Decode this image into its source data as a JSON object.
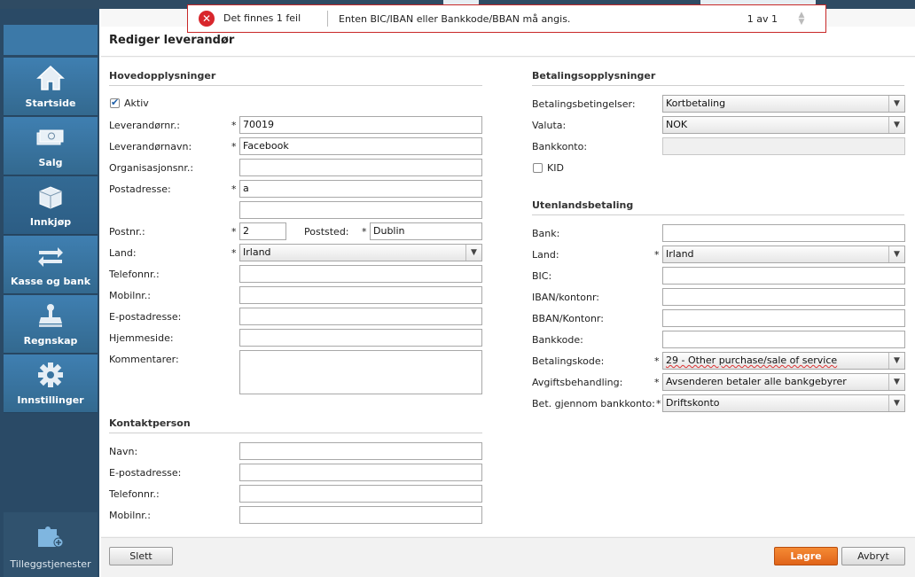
{
  "error_banner": {
    "count_text": "Det finnes 1 feil",
    "message": "Enten BIC/IBAN eller Bankkode/BBAN må angis.",
    "page": "1 av 1",
    "error_color": "#d8262c"
  },
  "sidebar": {
    "items": [
      {
        "label": "Startside",
        "icon": "home-icon"
      },
      {
        "label": "Salg",
        "icon": "money-icon"
      },
      {
        "label": "Innkjøp",
        "icon": "box-icon"
      },
      {
        "label": "Kasse og bank",
        "icon": "transfer-icon"
      },
      {
        "label": "Regnskap",
        "icon": "stamp-icon"
      },
      {
        "label": "Innstillinger",
        "icon": "gear-icon"
      }
    ],
    "addons_label": "Tilleggstjenester"
  },
  "page_title": "Rediger leverandør",
  "main_info": {
    "heading": "Hovedopplysninger",
    "active_label": "Aktiv",
    "active_checked": true,
    "supplier_no_label": "Leverandørnr.:",
    "supplier_no": "70019",
    "supplier_name_label": "Leverandørnavn:",
    "supplier_name": "Facebook",
    "org_no_label": "Organisasjonsnr.:",
    "org_no": "",
    "address_label": "Postadresse:",
    "address1": "a",
    "address2": "",
    "postal_no_label": "Postnr.:",
    "postal_no": "2",
    "city_label": "Poststed:",
    "city": "Dublin",
    "country_label": "Land:",
    "country": "Irland",
    "phone_label": "Telefonnr.:",
    "phone": "",
    "mobile_label": "Mobilnr.:",
    "mobile": "",
    "email_label": "E-postadresse:",
    "email": "",
    "website_label": "Hjemmeside:",
    "website": "",
    "comments_label": "Kommentarer:",
    "comments": "",
    "required_mark": "*"
  },
  "contact": {
    "heading": "Kontaktperson",
    "name_label": "Navn:",
    "email_label": "E-postadresse:",
    "phone_label": "Telefonnr.:",
    "mobile_label": "Mobilnr.:"
  },
  "payment": {
    "heading": "Betalingsopplysninger",
    "terms_label": "Betalingsbetingelser:",
    "terms": "Kortbetaling",
    "currency_label": "Valuta:",
    "currency": "NOK",
    "bank_account_label": "Bankkonto:",
    "bank_account": "",
    "kid_label": "KID",
    "kid_checked": false
  },
  "foreign": {
    "heading": "Utenlandsbetaling",
    "bank_label": "Bank:",
    "country_label": "Land:",
    "country": "Irland",
    "bic_label": "BIC:",
    "iban_label": "IBAN/kontonr:",
    "bban_label": "BBAN/Kontonr:",
    "bankcode_label": "Bankkode:",
    "paycode_label": "Betalingskode:",
    "paycode": "29 - Other purchase/sale of service",
    "fee_label": "Avgiftsbehandling:",
    "fee": "Avsenderen betaler alle bankgebyrer",
    "via_account_label": "Bet. gjennom bankkonto:",
    "via_account": "Driftskonto"
  },
  "footer": {
    "delete_label": "Slett",
    "save_label": "Lagre",
    "cancel_label": "Avbryt",
    "save_color": "#e8701f"
  }
}
